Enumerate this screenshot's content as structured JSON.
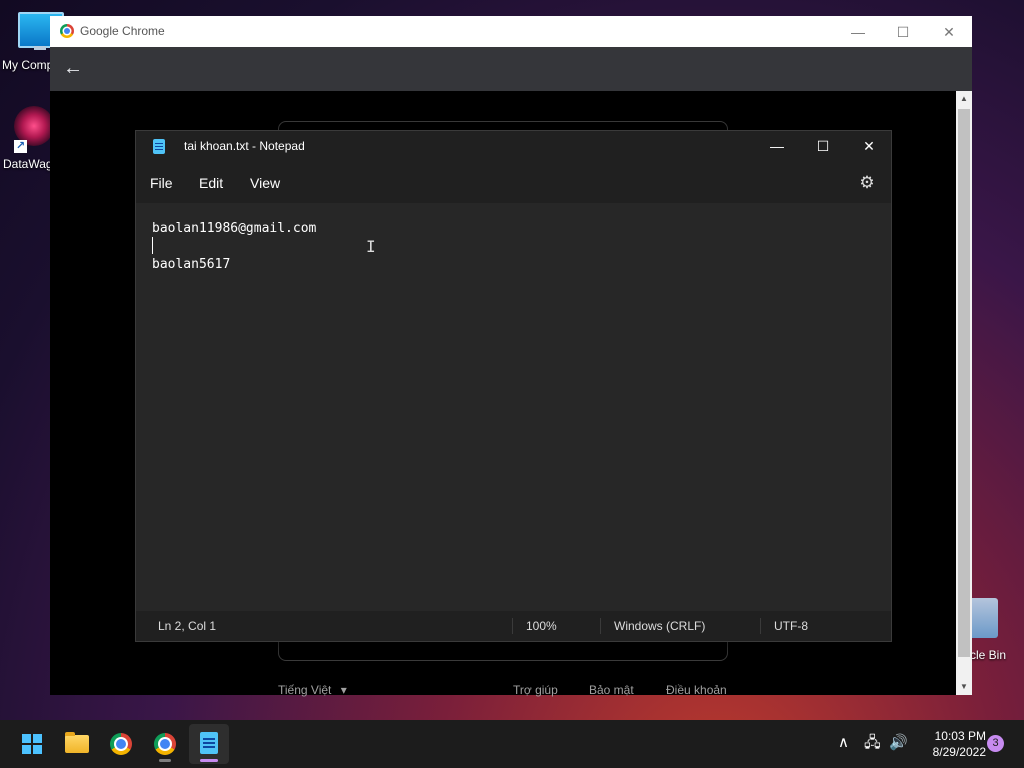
{
  "desktop": {
    "icons": [
      {
        "label": "My Comp",
        "icon": "monitor-icon"
      },
      {
        "label": "DataWag",
        "icon": "datawag-icon"
      },
      {
        "label": "cle Bin",
        "icon": "recycle-bin-icon"
      }
    ]
  },
  "chrome": {
    "title": "Google Chrome",
    "controls": {
      "minimize": "—",
      "maximize": "☐",
      "close": "✕"
    },
    "back": "←",
    "footer": {
      "language": "Tiếng Việt",
      "language_caret": "▾",
      "links": [
        "Trợ giúp",
        "Bảo mật",
        "Điều khoản"
      ]
    }
  },
  "notepad": {
    "title": "tai khoan.txt - Notepad",
    "controls": {
      "minimize": "—",
      "maximize": "☐",
      "close": "✕"
    },
    "menu": [
      "File",
      "Edit",
      "View"
    ],
    "settings_icon": "⚙",
    "lines": [
      "baolan11986@gmail.com",
      "",
      "baolan5617"
    ],
    "status": {
      "position": "Ln 2, Col 1",
      "zoom": "100%",
      "line_ending": "Windows (CRLF)",
      "encoding": "UTF-8"
    }
  },
  "taskbar": {
    "tray": {
      "chevron": "∧",
      "network": "🖧",
      "volume": "🔊"
    },
    "clock": {
      "time": "10:03 PM",
      "date": "8/29/2022"
    },
    "notifications": "3"
  }
}
